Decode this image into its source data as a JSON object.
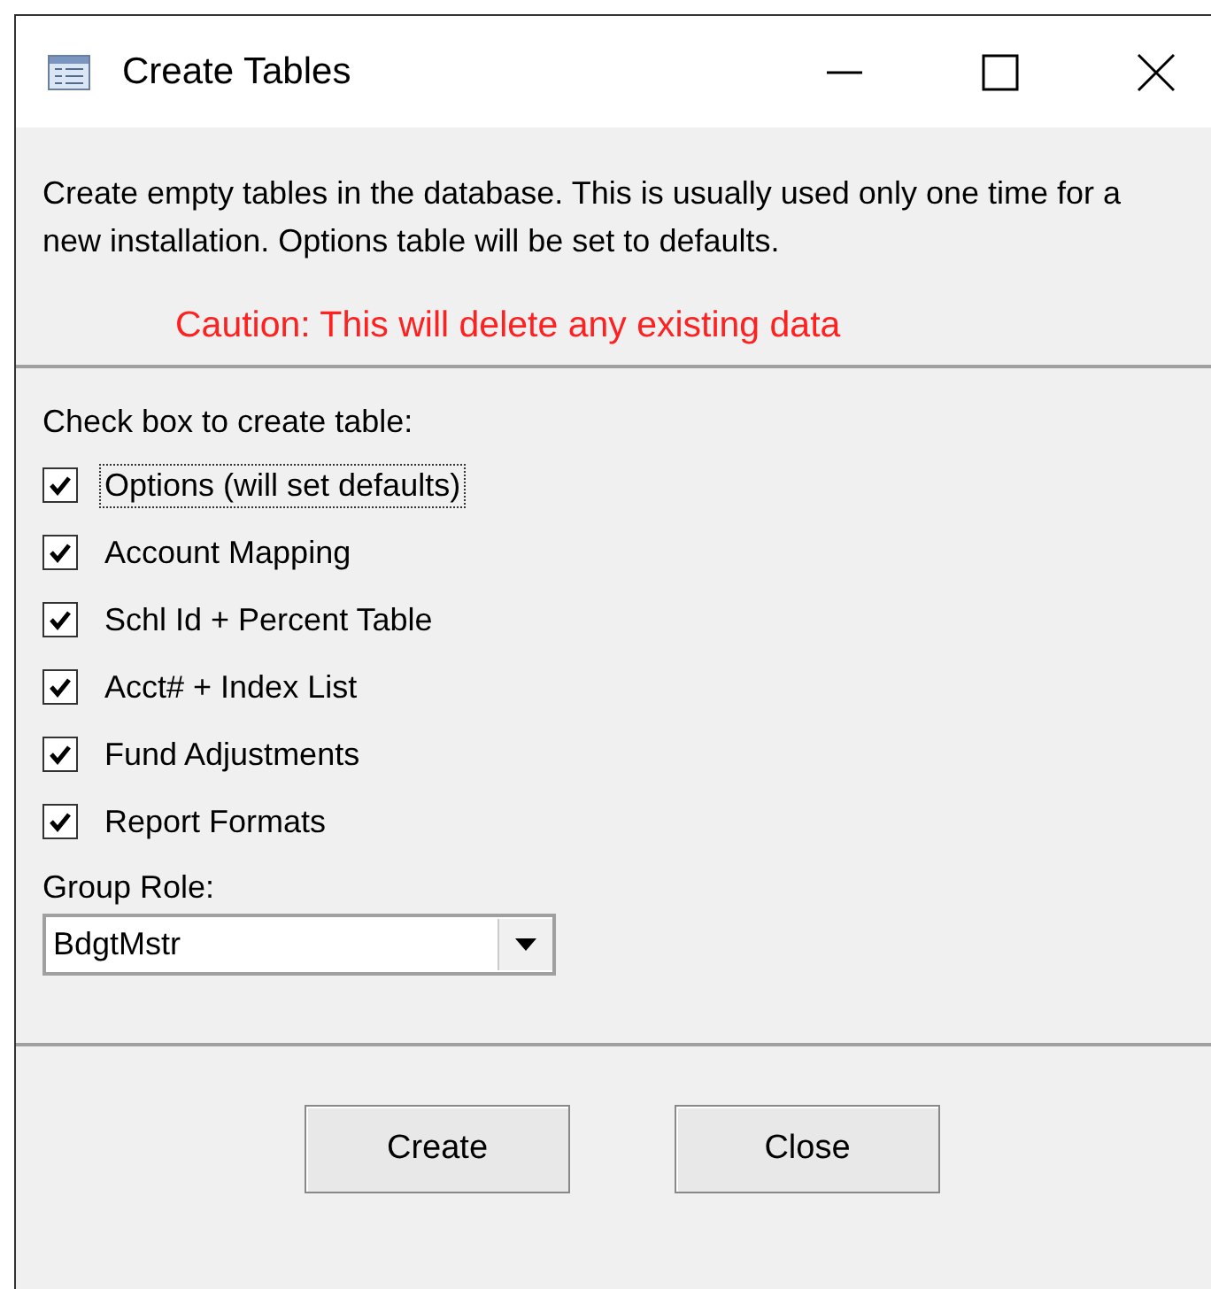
{
  "window": {
    "title": "Create Tables"
  },
  "description": "Create empty tables in the database. This is usually used only one time for a new installation. Options table will be set to defaults.",
  "caution": "Caution: This will delete any existing data",
  "checklist_label": "Check box to create table:",
  "tables": [
    {
      "label": "Options (will set defaults)",
      "checked": true,
      "focused": true
    },
    {
      "label": "Account Mapping",
      "checked": true,
      "focused": false
    },
    {
      "label": "Schl Id + Percent Table",
      "checked": true,
      "focused": false
    },
    {
      "label": "Acct# + Index List",
      "checked": true,
      "focused": false
    },
    {
      "label": "Fund Adjustments",
      "checked": true,
      "focused": false
    },
    {
      "label": "Report Formats",
      "checked": true,
      "focused": false
    }
  ],
  "group_role": {
    "label": "Group Role:",
    "value": "BdgtMstr"
  },
  "buttons": [
    "Create",
    "Close"
  ]
}
